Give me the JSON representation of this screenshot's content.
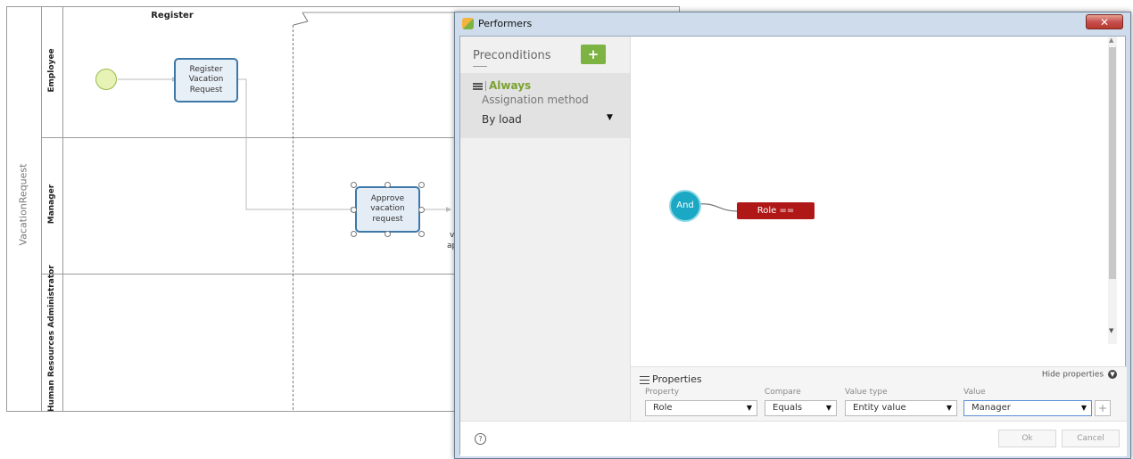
{
  "diagram": {
    "pool_name": "VacationRequest",
    "phase_name": "Register",
    "lanes": [
      "Employee",
      "Manager",
      "Human Resources Administrator"
    ],
    "tasks": {
      "register": "Register Vacation Request",
      "approve": "Approve vacation request"
    },
    "cut_label_top": "va",
    "cut_label_bottom": "ap"
  },
  "dialog": {
    "title": "Performers",
    "close_glyph": "✕",
    "preconditions": {
      "title": "Preconditions",
      "add_glyph": "+",
      "item_name": "Always",
      "assignment_label": "Assignation method",
      "assignment_value": "By load"
    },
    "graph": {
      "and_label": "And",
      "condition_label": "Role == Manager"
    },
    "properties": {
      "title": "Properties",
      "hide_label": "Hide properties",
      "columns": {
        "property": "Property",
        "compare": "Compare",
        "value_type": "Value type",
        "value": "Value"
      },
      "row": {
        "property": "Role",
        "compare": "Equals",
        "value_type": "Entity value",
        "value": "Manager"
      },
      "add_glyph": "+"
    },
    "footer": {
      "help_glyph": "?",
      "ok": "Ok",
      "cancel": "Cancel"
    }
  },
  "colors": {
    "accent_green": "#7cb342",
    "and_node": "#1aa8c4",
    "condition_node": "#b01818",
    "task_border": "#3c78a8"
  },
  "icons": [
    "performers-app-icon",
    "close-icon",
    "add-icon",
    "list-icon",
    "properties-icon",
    "chevron-down-icon",
    "help-icon"
  ]
}
